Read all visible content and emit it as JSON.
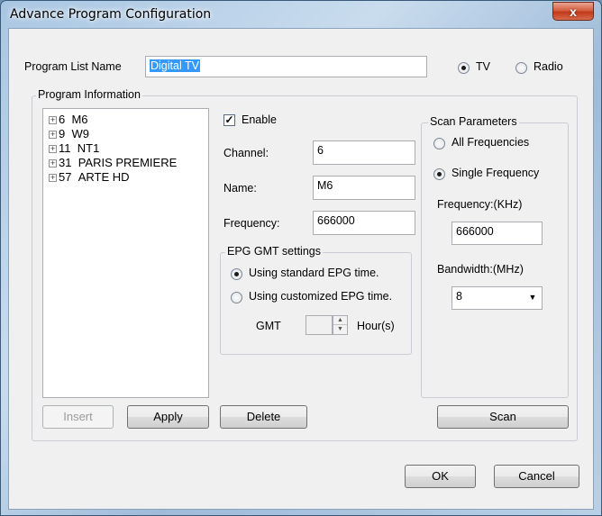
{
  "window": {
    "title": "Advance Program Configuration",
    "close_glyph": "x"
  },
  "program_list": {
    "label": "Program List Name",
    "value": "Digital TV",
    "type_options": [
      {
        "label": "TV",
        "selected": true
      },
      {
        "label": "Radio",
        "selected": false
      }
    ]
  },
  "program_info": {
    "title": "Program Information",
    "tree_items": [
      {
        "number": "6",
        "name": "M6"
      },
      {
        "number": "9",
        "name": "W9"
      },
      {
        "number": "11",
        "name": "NT1"
      },
      {
        "number": "31",
        "name": "PARIS PREMIERE"
      },
      {
        "number": "57",
        "name": "ARTE HD"
      }
    ],
    "expander_glyph": "+",
    "enable_label": "Enable",
    "enable_checked": true,
    "channel_label": "Channel:",
    "channel_value": "6",
    "name_label": "Name:",
    "name_value": "M6",
    "frequency_label": "Frequency:",
    "frequency_value": "666000"
  },
  "epg": {
    "title": "EPG GMT settings",
    "standard_label": "Using standard EPG time.",
    "customized_label": "Using customized EPG time.",
    "selected": "standard",
    "gmt_label": "GMT",
    "gmt_value": "",
    "hours_label": "Hour(s)"
  },
  "scan": {
    "title": "Scan Parameters",
    "all_label": "All Frequencies",
    "single_label": "Single Frequency",
    "selected": "single",
    "frequency_label": "Frequency:(KHz)",
    "frequency_value": "666000",
    "bandwidth_label": "Bandwidth:(MHz)",
    "bandwidth_value": "8"
  },
  "buttons": {
    "insert": "Insert",
    "apply": "Apply",
    "delete": "Delete",
    "scan": "Scan",
    "ok": "OK",
    "cancel": "Cancel"
  }
}
